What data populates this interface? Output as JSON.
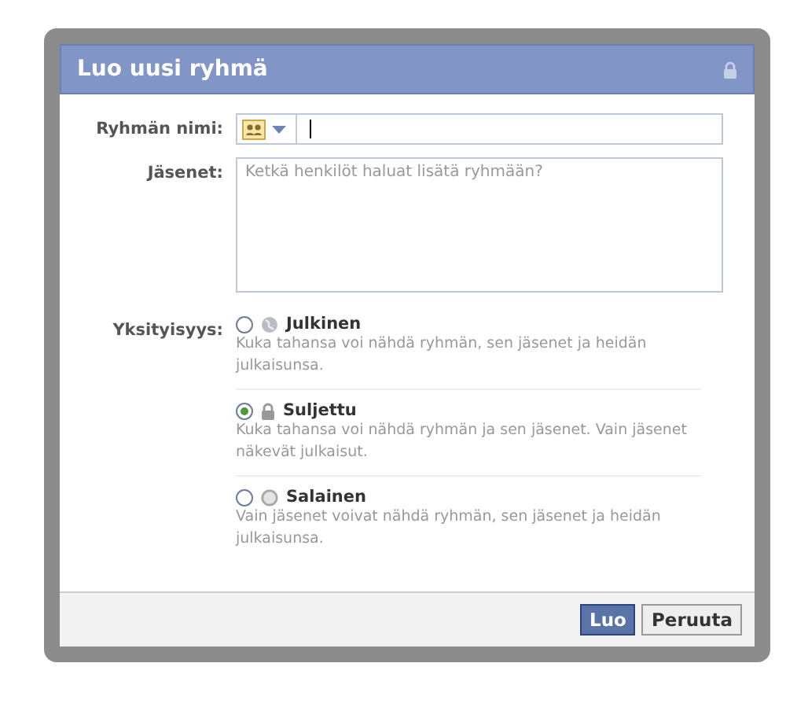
{
  "dialog": {
    "title": "Luo uusi ryhmä",
    "fields": [
      {
        "kind": "name",
        "label": "Ryhmän nimi:"
      },
      {
        "kind": "members",
        "label": "Jäsenet:",
        "placeholder": "Ketkä henkilöt haluat lisätä ryhmään?"
      }
    ],
    "privacy": {
      "label": "Yksityisyys:",
      "options": [
        {
          "kind": "globe",
          "title": "Julkinen",
          "description": "Kuka tahansa voi nähdä ryhmän, sen jäsenet ja heidän julkaisunsa.",
          "selected": false
        },
        {
          "kind": "lock",
          "title": "Suljettu",
          "description": "Kuka tahansa voi nähdä ryhmän ja sen jäsenet. Vain jäsenet näkevät julkaisut.",
          "selected": true
        },
        {
          "kind": "circle",
          "title": "Salainen",
          "description": "Vain jäsenet voivat nähdä ryhmän, sen jäsenet ja heidän julkaisunsa.",
          "selected": false
        }
      ]
    },
    "buttons": [
      {
        "kind": "primary",
        "label": "Luo"
      },
      {
        "kind": "secondary",
        "label": "Peruuta"
      }
    ]
  }
}
